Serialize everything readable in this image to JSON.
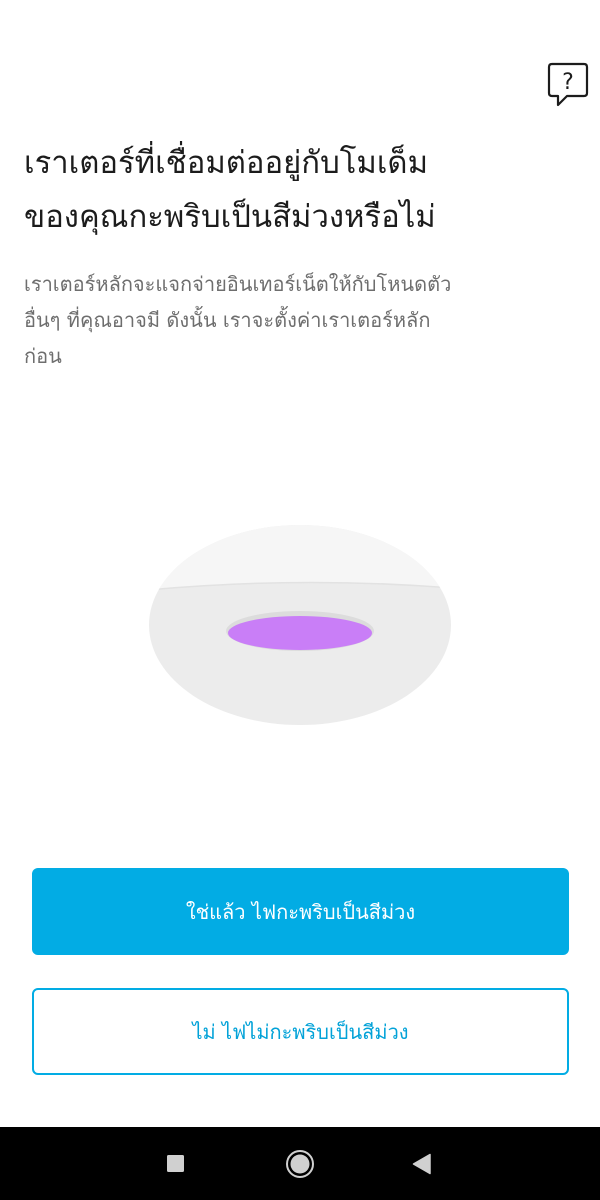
{
  "help": {
    "icon": "question-mark-icon",
    "glyph": "?"
  },
  "title": {
    "line1": "เราเตอร์ที่เชื่อมต่ออยู่กับโมเด็ม",
    "line2": "ของคุณกะพริบเป็นสีม่วงหรือไม่"
  },
  "description": {
    "line1": "เราเตอร์หลักจะแจกจ่ายอินเทอร์เน็ตให้กับโหนดตัว",
    "line2": "อื่นๆ ที่คุณอาจมี ดังนั้น เราจะตั้งค่าเราเตอร์หลัก",
    "line3": "ก่อน"
  },
  "illustration": {
    "icon": "router-purple-light-icon",
    "light_color": "#c97ef7",
    "body_color": "#ececec"
  },
  "buttons": {
    "yes_label": "ใช่แล้ว ไฟกะพริบเป็นสีม่วง",
    "no_label": "ไม่ ไฟไม่กะพริบเป็นสีม่วง",
    "accent_color": "#02ace4"
  },
  "navbar": {
    "recents_icon": "square-recents-icon",
    "home_icon": "circle-home-icon",
    "back_icon": "triangle-back-icon"
  }
}
